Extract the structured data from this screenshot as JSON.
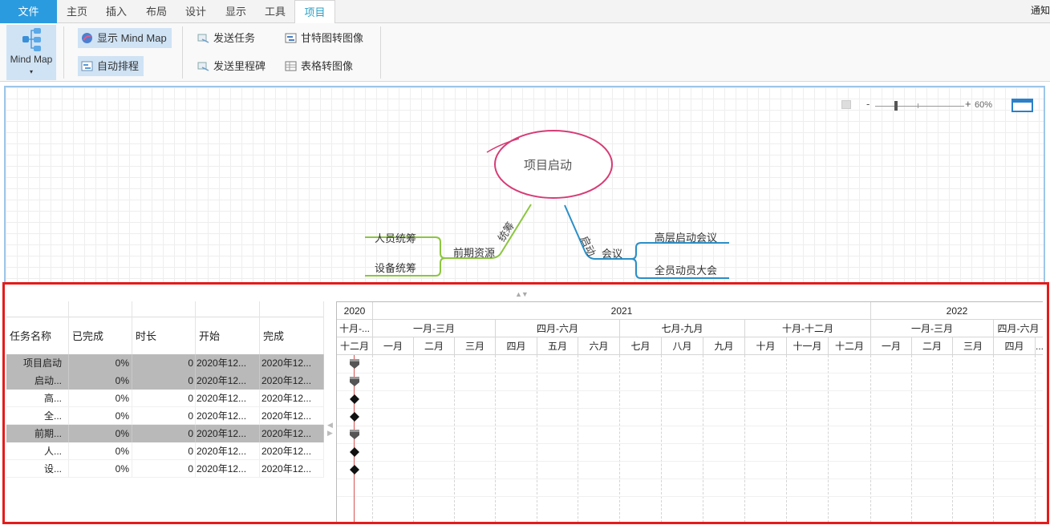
{
  "menu": {
    "file": "文件",
    "tabs": [
      "主页",
      "插入",
      "布局",
      "设计",
      "显示",
      "工具",
      "项目"
    ],
    "notify": "通知"
  },
  "ribbon": {
    "mindmap_label": "Mind Map",
    "mindmap_arrow": "▾",
    "show_mindmap": "显示 Mind Map",
    "auto_schedule": "自动排程",
    "send_task": "发送任务",
    "send_milestone": "发送里程碑",
    "gantt_to_image": "甘特图转图像",
    "table_to_image": "表格转图像"
  },
  "zoom": {
    "minus": "-",
    "plus": "+",
    "level": "60%"
  },
  "mindmap": {
    "root": "项目启动",
    "left_branch": {
      "label": "统筹",
      "node": "前期资源",
      "children": [
        "人员统筹",
        "设备统筹"
      ]
    },
    "right_branch": {
      "label": "启动",
      "node": "会议",
      "children": [
        "高层启动会议",
        "全员动员大会"
      ]
    }
  },
  "table": {
    "headers": [
      "任务名称",
      "已完成",
      "时长",
      "开始",
      "完成"
    ],
    "rows": [
      {
        "name": "项目启动",
        "done": "0%",
        "dur": "0",
        "start": "2020年12...",
        "end": "2020年12...",
        "summary": true
      },
      {
        "name": "启动...",
        "done": "0%",
        "dur": "0",
        "start": "2020年12...",
        "end": "2020年12...",
        "summary": true
      },
      {
        "name": "高...",
        "done": "0%",
        "dur": "0",
        "start": "2020年12...",
        "end": "2020年12...",
        "summary": false
      },
      {
        "name": "全...",
        "done": "0%",
        "dur": "0",
        "start": "2020年12...",
        "end": "2020年12...",
        "summary": false
      },
      {
        "name": "前期...",
        "done": "0%",
        "dur": "0",
        "start": "2020年12...",
        "end": "2020年12...",
        "summary": true
      },
      {
        "name": "人...",
        "done": "0%",
        "dur": "0",
        "start": "2020年12...",
        "end": "2020年12...",
        "summary": false
      },
      {
        "name": "设...",
        "done": "0%",
        "dur": "0",
        "start": "2020年12...",
        "end": "2020年12...",
        "summary": false
      }
    ]
  },
  "timeline": {
    "years": [
      "2020",
      "2021",
      "2022"
    ],
    "quarters": [
      "十月-...",
      "一月-三月",
      "四月-六月",
      "七月-九月",
      "十月-十二月",
      "一月-三月",
      "四月-六月"
    ],
    "months": [
      "十二月",
      "一月",
      "二月",
      "三月",
      "四月",
      "五月",
      "六月",
      "七月",
      "八月",
      "九月",
      "十月",
      "十一月",
      "十二月",
      "一月",
      "二月",
      "三月",
      "四月",
      "..."
    ]
  },
  "colors": {
    "file_tab": "#2b9be0",
    "left_branch": "#8cc63f",
    "right_branch": "#2a8fc7",
    "root_border": "#d63c75",
    "frame": "#e41b1b"
  }
}
